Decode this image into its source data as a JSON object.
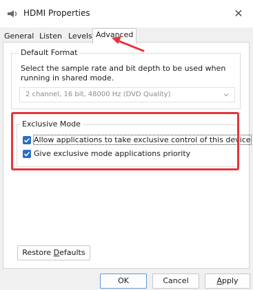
{
  "window": {
    "title": "HDMI Properties",
    "close_glyph": "✕",
    "icon": "speaker-icon"
  },
  "tabs": [
    {
      "label": "General"
    },
    {
      "label": "Listen"
    },
    {
      "label": "Levels"
    },
    {
      "label": "Advanced",
      "active": true
    }
  ],
  "default_format": {
    "group_label": "Default Format",
    "description": "Select the sample rate and bit depth to be used when running in shared mode.",
    "selected_value": "2 channel, 16 bit, 48000 Hz (DVD Quality)"
  },
  "exclusive_mode": {
    "group_label": "Exclusive Mode",
    "allow_label": "Allow applications to take exclusive control of this device",
    "allow_checked": true,
    "priority_label": "Give exclusive mode applications priority",
    "priority_checked": true
  },
  "buttons": {
    "restore_prefix": "Restore ",
    "restore_accel": "D",
    "restore_suffix": "efaults",
    "ok": "OK",
    "cancel": "Cancel",
    "apply_accel": "A",
    "apply_suffix": "pply"
  },
  "colors": {
    "annotation_red": "#e8333a",
    "checkbox_blue": "#2c6fc2"
  }
}
